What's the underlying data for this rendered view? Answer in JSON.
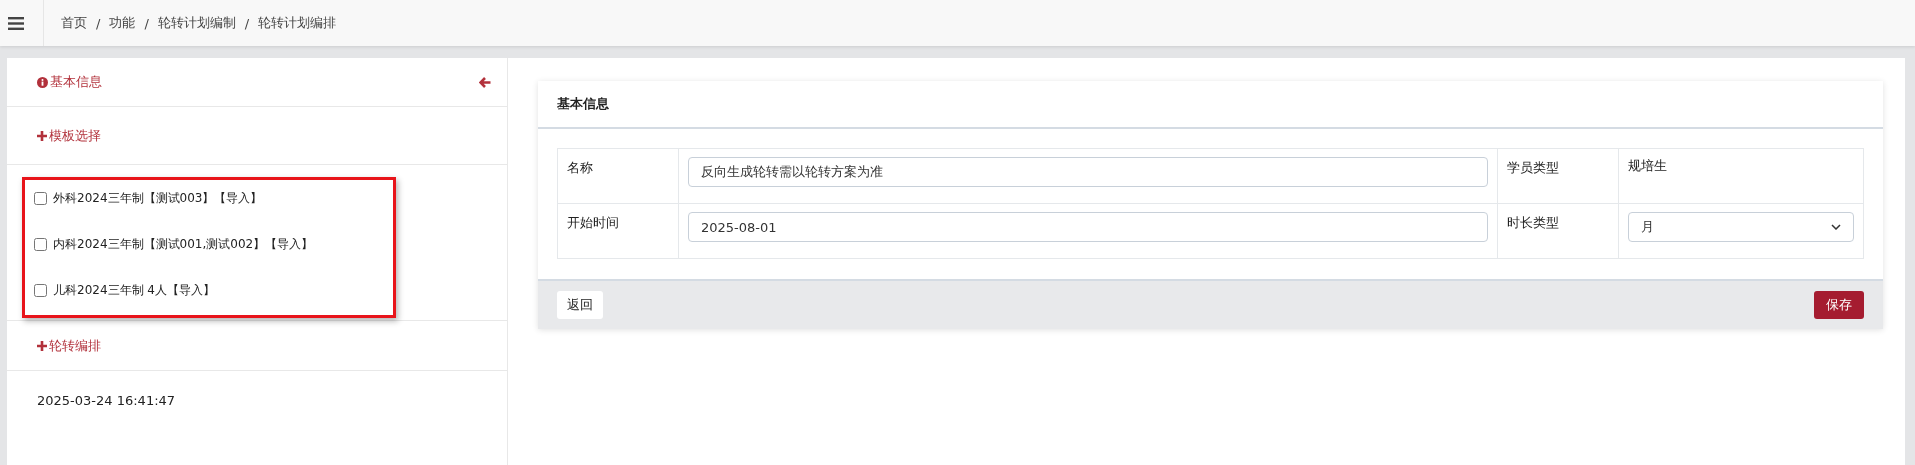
{
  "breadcrumb": [
    "首页",
    "功能",
    "轮转计划编制",
    "轮转计划编排"
  ],
  "breadcrumb_separator": "/",
  "sidebar": {
    "info_title": "基本信息",
    "template_title": "模板选择",
    "templates": [
      {
        "label": "外科2024三年制【测试003】【导入】",
        "checked": false
      },
      {
        "label": "内科2024三年制【测试001,测试002】【导入】",
        "checked": false
      },
      {
        "label": "儿科2024三年制 4人【导入】",
        "checked": false
      }
    ],
    "highlighted": true,
    "schedule_title": "轮转编排",
    "timestamp": "2025-03-24 16:41:47"
  },
  "card": {
    "title": "基本信息",
    "fields": [
      {
        "label": "名称",
        "kind": "input",
        "value": "反向生成轮转需以轮转方案为准"
      },
      {
        "label": "学员类型",
        "kind": "text",
        "value": "规培生"
      },
      {
        "label": "开始时间",
        "kind": "input",
        "value": "2025-08-01"
      },
      {
        "label": "时长类型",
        "kind": "select",
        "value": "月"
      }
    ],
    "back_button": "返回",
    "save_button": "保存"
  }
}
